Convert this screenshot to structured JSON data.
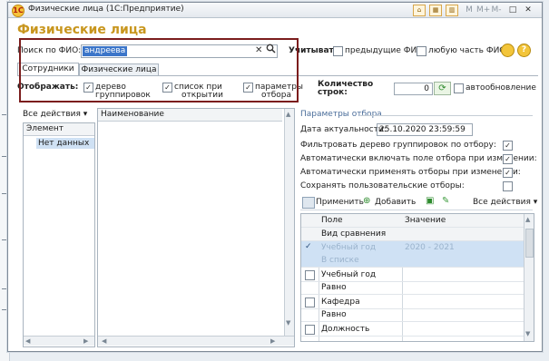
{
  "window": {
    "title": "Физические лица (1С:Предприятие)",
    "titlebar_buttons": [
      "M",
      "M+",
      "M-",
      "□",
      "✕"
    ]
  },
  "form": {
    "title": "Физические лица",
    "search_label": "Поиск по ФИО:",
    "search_value": "андреева",
    "consider_label": "Учитывать:",
    "opt_previous_fio": "предыдущие ФИО",
    "opt_any_part": "любую часть ФИО"
  },
  "tabs": [
    {
      "label": "Сотрудники",
      "active": true
    },
    {
      "label": "Физические лица",
      "active": false
    }
  ],
  "display": {
    "label": "Отображать:",
    "opt_tree_1": "дерево",
    "opt_tree_2": "группировок",
    "opt_list_1": "список при",
    "opt_list_2": "открытии",
    "opt_params_1": "параметры",
    "opt_params_2": "отбора",
    "rows_label_1": "Количество",
    "rows_label_2": "строк:",
    "rows_value": "0",
    "autoupdate": "автообновление"
  },
  "left_panel": {
    "all_actions": "Все действия ▾",
    "col_element": "Элемент",
    "no_data": "Нет данных",
    "col_name": "Наименование"
  },
  "filter_panel": {
    "group_title": "Параметры отбора",
    "date_label": "Дата актуальности:",
    "date_value": "25.10.2020 23:59:59",
    "options": [
      {
        "label": "Фильтровать дерево группировок по отбору:",
        "checked": true
      },
      {
        "label": "Автоматически включать поле отбора при изменении:",
        "checked": true
      },
      {
        "label": "Автоматически применять отборы при изменении:",
        "checked": true
      },
      {
        "label": "Сохранять пользовательские отборы:",
        "checked": false
      }
    ],
    "apply": "Применить",
    "add": "Добавить",
    "all_actions": "Все действия ▾",
    "col_field": "Поле",
    "col_value": "Значение",
    "col_compare": "Вид сравнения",
    "rows": [
      {
        "field": "Учебный год",
        "value": "2020 - 2021",
        "checked": true,
        "selected": true
      },
      {
        "field": "В списке",
        "value": "",
        "checked": null,
        "selected": true
      },
      {
        "field": "Учебный год",
        "value": "",
        "checked": false,
        "selected": false
      },
      {
        "field": "Равно",
        "value": "",
        "checked": null,
        "selected": false
      },
      {
        "field": "Кафедра",
        "value": "",
        "checked": false,
        "selected": false
      },
      {
        "field": "Равно",
        "value": "",
        "checked": null,
        "selected": false
      },
      {
        "field": "Должность",
        "value": "",
        "checked": false,
        "selected": false
      }
    ]
  }
}
